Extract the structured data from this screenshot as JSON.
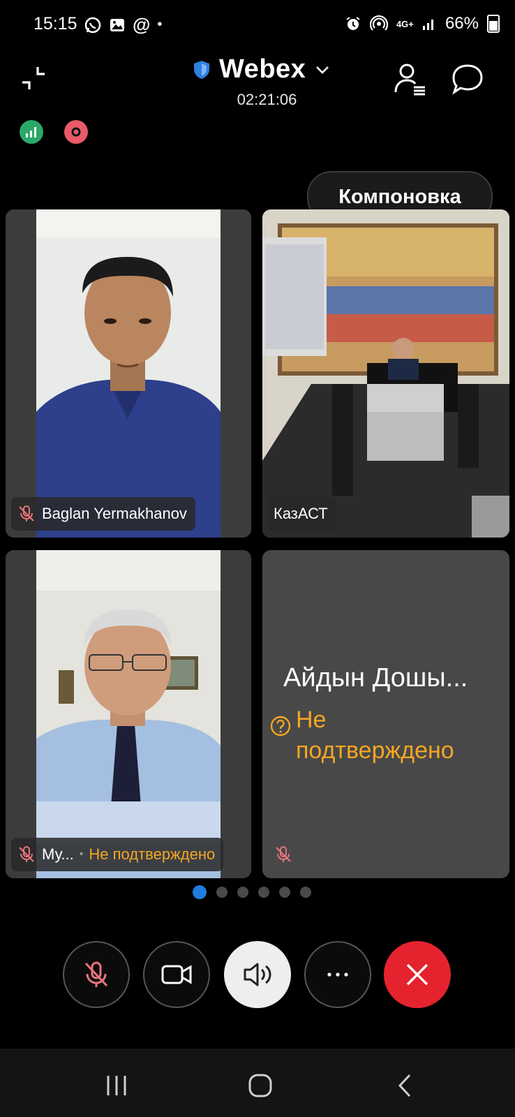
{
  "status_bar": {
    "time": "15:15",
    "network": "4G+",
    "battery": "66%"
  },
  "header": {
    "title": "Webex",
    "timer": "02:21:06"
  },
  "layout_button": {
    "label": "Компоновка"
  },
  "participants": [
    {
      "name": "Baglan Yermakhanov",
      "muted": true
    },
    {
      "name": "КазАСТ",
      "muted": false
    },
    {
      "name": "Му...",
      "status": "Не подтверждено",
      "muted": true
    },
    {
      "name": "Айдын Дошы...",
      "status_line1": "Не",
      "status_line2": "подтверждено",
      "muted": true
    }
  ],
  "pagination": {
    "pages": 6,
    "active": 1
  },
  "controls": {
    "mute": "mic-muted-icon",
    "video": "video-camera-icon",
    "audio": "speaker-icon",
    "more": "more-icon",
    "end": "close-icon"
  },
  "colors": {
    "accent": "#1f7de0",
    "warning": "#f5a623",
    "end_call": "#e5232f",
    "mic_muted": "#e8747c"
  }
}
